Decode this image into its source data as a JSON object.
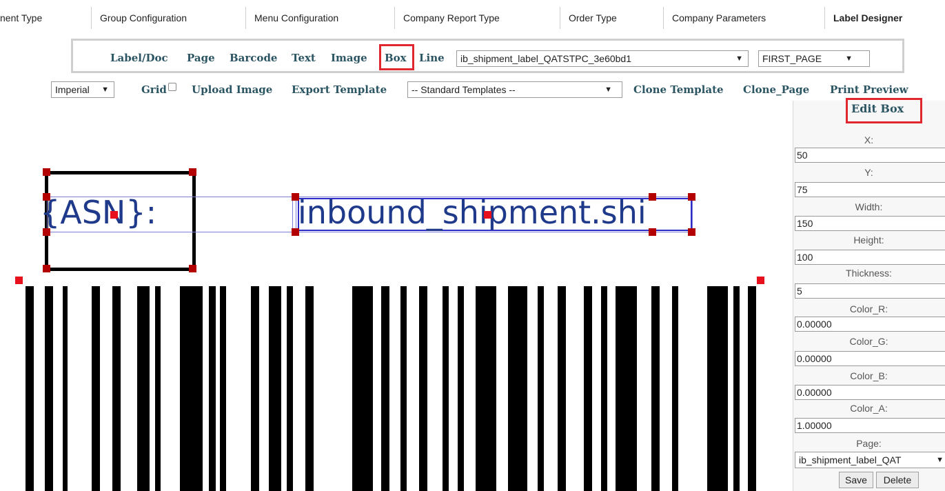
{
  "tabs": [
    {
      "label": "nent Type"
    },
    {
      "label": "Group Configuration"
    },
    {
      "label": "Menu Configuration"
    },
    {
      "label": "Company Report Type"
    },
    {
      "label": "Order Type"
    },
    {
      "label": "Company Parameters"
    },
    {
      "label": "Label Designer",
      "active": true
    }
  ],
  "toolbar": {
    "label_doc": "Label/Doc",
    "page": "Page",
    "barcode": "Barcode",
    "text": "Text",
    "image": "Image",
    "box": "Box",
    "line": "Line",
    "template_select": "ib_shipment_label_QATSTPC_3e60bd1",
    "page_select": "FIRST_PAGE"
  },
  "toolbar2": {
    "units": "Imperial",
    "grid": "Grid",
    "grid_checked": false,
    "upload_image": "Upload Image",
    "export_template": "Export Template",
    "standard_templates": "-- Standard Templates --",
    "clone_template": "Clone Template",
    "clone_page": "Clone_Page",
    "print_preview": "Print Preview"
  },
  "canvas": {
    "text1": "{ASN}:",
    "text2": "inbound_shipment.shi"
  },
  "edit_box": {
    "title": "Edit Box",
    "fields": {
      "x": {
        "label": "X:",
        "value": "50"
      },
      "y": {
        "label": "Y:",
        "value": "75"
      },
      "width": {
        "label": "Width:",
        "value": "150"
      },
      "height": {
        "label": "Height:",
        "value": "100"
      },
      "thickness": {
        "label": "Thickness:",
        "value": "5"
      },
      "color_r": {
        "label": "Color_R:",
        "value": "0.00000"
      },
      "color_g": {
        "label": "Color_G:",
        "value": "0.00000"
      },
      "color_b": {
        "label": "Color_B:",
        "value": "0.00000"
      },
      "color_a": {
        "label": "Color_A:",
        "value": "1.00000"
      },
      "page": {
        "label": "Page:",
        "value": "ib_shipment_label_QAT"
      }
    },
    "save": "Save",
    "delete": "Delete"
  },
  "colors": {
    "accent_text": "#2b5563",
    "highlight": "#e0262f",
    "canvas_text": "#1f3a8a",
    "handle": "#b30000"
  },
  "icons": {
    "dropdown": "chevron-down-icon",
    "checkbox": "checkbox-icon",
    "handle": "resize-handle-icon"
  }
}
